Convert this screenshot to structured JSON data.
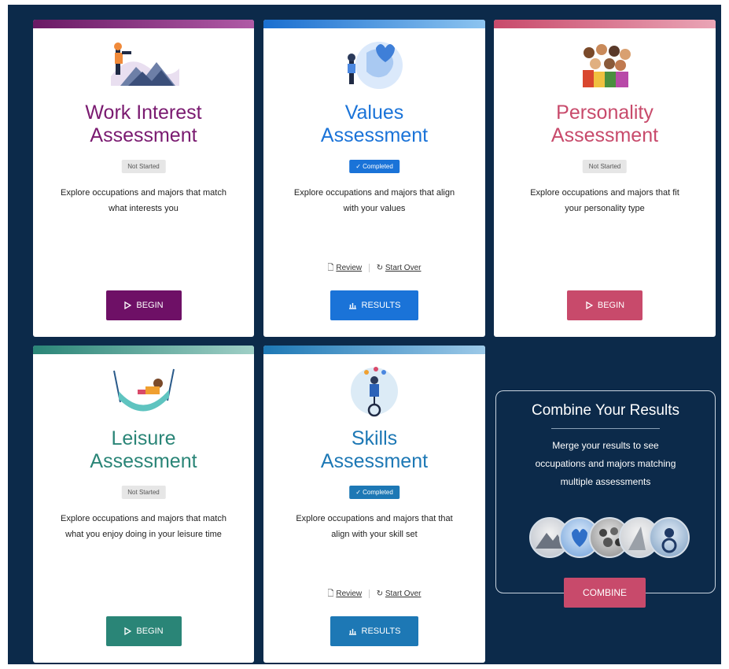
{
  "cards": [
    {
      "title_line1": "Work Interest",
      "title_line2": "Assessment",
      "status": "Not Started",
      "description_line1": "Explore occupations and majors that match",
      "description_line2": "what interests you",
      "button_label": "BEGIN",
      "color": "#7a1a70"
    },
    {
      "title_line1": "Values",
      "title_line2": "Assessment",
      "status": "Completed",
      "description_line1": "Explore occupations and majors that align",
      "description_line2": "with your values",
      "review_label": "Review",
      "start_over_label": "Start Over",
      "button_label": "RESULTS",
      "color": "#1a73d8"
    },
    {
      "title_line1": "Personality",
      "title_line2": "Assessment",
      "status": "Not Started",
      "description_line1": "Explore occupations and majors that fit",
      "description_line2": "your personality type",
      "button_label": "BEGIN",
      "color": "#c84a6b"
    },
    {
      "title_line1": "Leisure",
      "title_line2": "Assessment",
      "status": "Not Started",
      "description_line1": "Explore occupations and majors that match",
      "description_line2": "what you enjoy doing in your leisure time",
      "button_label": "BEGIN",
      "color": "#2a8577"
    },
    {
      "title_line1": "Skills",
      "title_line2": "Assessment",
      "status": "Completed",
      "description_line1": "Explore occupations and majors that that",
      "description_line2": "align with your skill set",
      "review_label": "Review",
      "start_over_label": "Start Over",
      "button_label": "RESULTS",
      "color": "#1d78b5"
    }
  ],
  "combine": {
    "title": "Combine Your Results",
    "description_line1": "Merge your results to see",
    "description_line2": "occupations and majors matching",
    "description_line3": "multiple assessments",
    "button_label": "COMBINE"
  },
  "icons": {
    "begin": "play-icon",
    "results": "bar-chart-icon",
    "review": "document-icon",
    "start_over": "refresh-icon",
    "completed": "check-icon"
  },
  "colors": {
    "background": "#0c2a4a",
    "card": "#ffffff"
  }
}
